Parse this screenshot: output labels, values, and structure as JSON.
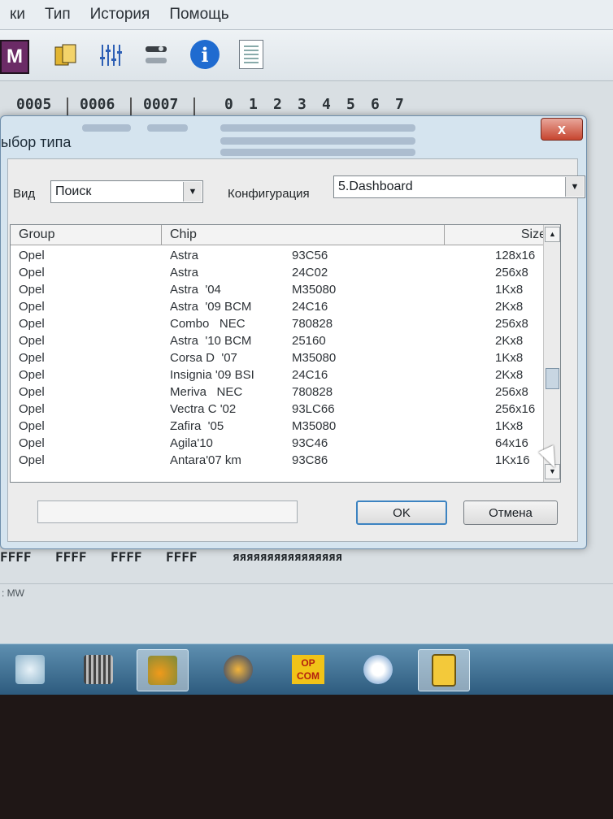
{
  "menu": [
    "ки",
    "Тип",
    "История",
    "Помощь"
  ],
  "toolbar": {
    "m_label": "M",
    "info_label": "i"
  },
  "hex_header": {
    "addresses": [
      "0005",
      "0006",
      "0007"
    ],
    "digits": [
      "0",
      "1",
      "2",
      "3",
      "4",
      "5",
      "6",
      "7"
    ]
  },
  "bg_hex": {
    "left_chars": [
      "F",
      "F",
      "F",
      "F",
      "F",
      "F",
      "F",
      "F",
      "F",
      "F"
    ],
    "bottom_row": [
      "FFFF",
      "FFFF",
      "FFFF",
      "FFFF"
    ],
    "ascii": "яяяяяяяяяяяяяяяя",
    "status": ": MW"
  },
  "dialog": {
    "title": "ыбор типа",
    "close_label": "x",
    "vid_label": "Вид",
    "vid_value": "Поиск",
    "config_label": "Конфигурация",
    "config_value": "5.Dashboard",
    "ok_label": "OK",
    "cancel_label": "Отмена"
  },
  "table": {
    "headers": [
      "Group",
      "Chip",
      "Size"
    ],
    "rows": [
      {
        "group": "Opel",
        "chip": "Astra",
        "code": "93C56",
        "size": "128x16"
      },
      {
        "group": "Opel",
        "chip": "Astra",
        "code": "24C02",
        "size": "256x8"
      },
      {
        "group": "Opel",
        "chip": "Astra  '04",
        "code": "M35080",
        "size": "1Kx8"
      },
      {
        "group": "Opel",
        "chip": "Astra  '09 BCM",
        "code": "24C16",
        "size": "2Kx8"
      },
      {
        "group": "Opel",
        "chip": "Combo   NEC",
        "code": "780828",
        "size": "256x8"
      },
      {
        "group": "Opel",
        "chip": "Astra  '10 BCM",
        "code": "25160",
        "size": "2Kx8"
      },
      {
        "group": "Opel",
        "chip": "Corsa D  '07",
        "code": "M35080",
        "size": "1Kx8"
      },
      {
        "group": "Opel",
        "chip": "Insignia '09 BSI",
        "code": "24C16",
        "size": "2Kx8"
      },
      {
        "group": "Opel",
        "chip": "Meriva   NEC",
        "code": "780828",
        "size": "256x8"
      },
      {
        "group": "Opel",
        "chip": "Vectra C '02",
        "code": "93LC66",
        "size": "256x16"
      },
      {
        "group": "Opel",
        "chip": "Zafira  '05",
        "code": "M35080",
        "size": "1Kx8"
      },
      {
        "group": "Opel",
        "chip": "Agila'10",
        "code": "93C46",
        "size": "64x16"
      },
      {
        "group": "Opel",
        "chip": "Antara'07 km",
        "code": "93C86",
        "size": "1Kx16"
      }
    ]
  },
  "taskbar": {
    "opcom_line1": "OP",
    "opcom_line2": "COM"
  }
}
